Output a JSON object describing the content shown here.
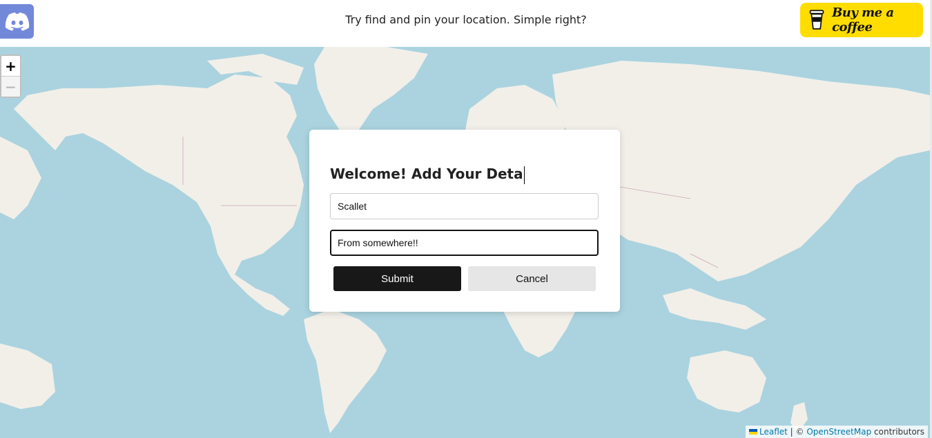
{
  "header": {
    "tagline": "Try find and pin your location. Simple right?",
    "coffee_label": "Buy me a coffee",
    "discord_icon": "discord-icon",
    "coffee_icon": "coffee-cup-icon"
  },
  "map": {
    "zoom_in_label": "+",
    "zoom_out_label": "−",
    "attribution": {
      "leaflet": "Leaflet",
      "separator": " | © ",
      "osm": "OpenStreetMap",
      "contributors": " contributors"
    }
  },
  "modal": {
    "title": "Welcome! Add Your Deta",
    "name_value": "Scallet",
    "description_value": "From somewhere!!",
    "submit_label": "Submit",
    "cancel_label": "Cancel"
  },
  "colors": {
    "discord": "#7289da",
    "coffee": "#ffdd00",
    "water": "#aad3df",
    "land": "#f2efe9"
  }
}
